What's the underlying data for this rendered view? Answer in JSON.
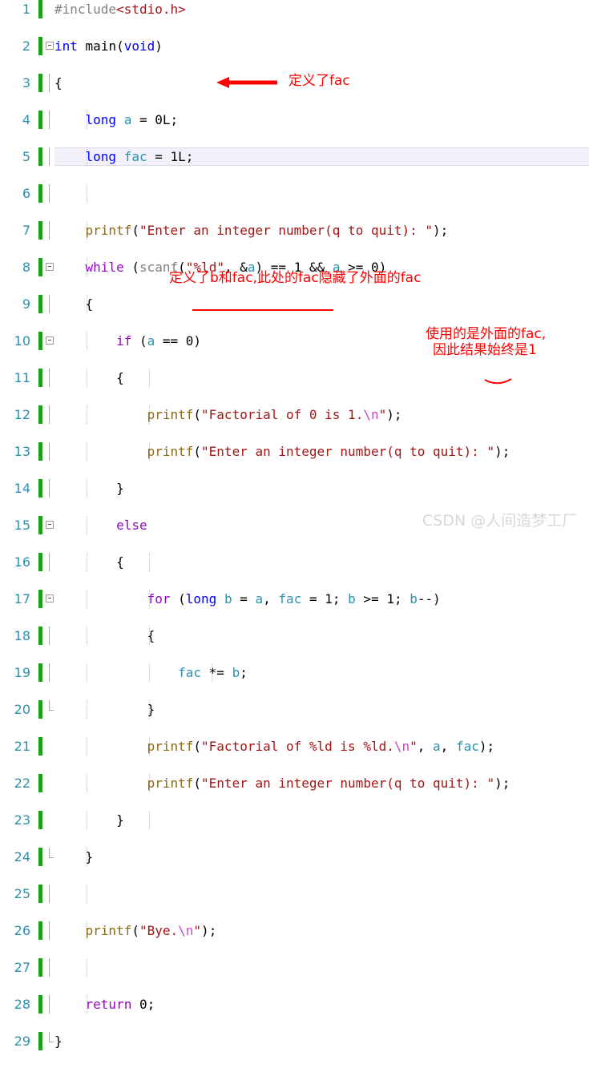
{
  "editor": {
    "language": "c",
    "current_line": 5,
    "line_number_color": "#2b91af",
    "modified_bar_color": "#16a016",
    "current_line_highlight": "#f2f0f8",
    "lines": [
      {
        "n": "1",
        "indent": 0,
        "fold": "none"
      },
      {
        "n": "2",
        "indent": 0,
        "fold": "open"
      },
      {
        "n": "3",
        "indent": 0,
        "fold": "none"
      },
      {
        "n": "4",
        "indent": 1,
        "fold": "none"
      },
      {
        "n": "5",
        "indent": 1,
        "fold": "none"
      },
      {
        "n": "6",
        "indent": 1,
        "fold": "none"
      },
      {
        "n": "7",
        "indent": 1,
        "fold": "none"
      },
      {
        "n": "8",
        "indent": 1,
        "fold": "open"
      },
      {
        "n": "9",
        "indent": 1,
        "fold": "none"
      },
      {
        "n": "10",
        "indent": 2,
        "fold": "open"
      },
      {
        "n": "11",
        "indent": 2,
        "fold": "none"
      },
      {
        "n": "12",
        "indent": 3,
        "fold": "none"
      },
      {
        "n": "13",
        "indent": 3,
        "fold": "none"
      },
      {
        "n": "14",
        "indent": 2,
        "fold": "none"
      },
      {
        "n": "15",
        "indent": 2,
        "fold": "open"
      },
      {
        "n": "16",
        "indent": 2,
        "fold": "none"
      },
      {
        "n": "17",
        "indent": 3,
        "fold": "open"
      },
      {
        "n": "18",
        "indent": 3,
        "fold": "none"
      },
      {
        "n": "19",
        "indent": 4,
        "fold": "none"
      },
      {
        "n": "20",
        "indent": 3,
        "fold": "none"
      },
      {
        "n": "21",
        "indent": 3,
        "fold": "none"
      },
      {
        "n": "22",
        "indent": 3,
        "fold": "none"
      },
      {
        "n": "23",
        "indent": 2,
        "fold": "none"
      },
      {
        "n": "24",
        "indent": 1,
        "fold": "none"
      },
      {
        "n": "25",
        "indent": 1,
        "fold": "none"
      },
      {
        "n": "26",
        "indent": 1,
        "fold": "none"
      },
      {
        "n": "27",
        "indent": 1,
        "fold": "none"
      },
      {
        "n": "28",
        "indent": 1,
        "fold": "none"
      },
      {
        "n": "29",
        "indent": 0,
        "fold": "none"
      }
    ],
    "code_text": {
      "l1": "#include<stdio.h>",
      "l2": "int main(void)",
      "l3": "{",
      "l4": "    long a = 0L;",
      "l5": "    long fac = 1L;",
      "l6": "",
      "l7": "    printf(\"Enter an integer number(q to quit): \");",
      "l8": "    while (scanf(\"%ld\", &a) == 1 && a >= 0)",
      "l9": "    {",
      "l10": "        if (a == 0)",
      "l11": "        {",
      "l12": "            printf(\"Factorial of 0 is 1.\\n\");",
      "l13": "            printf(\"Enter an integer number(q to quit): \");",
      "l14": "        }",
      "l15": "        else",
      "l16": "        {",
      "l17": "            for (long b = a, fac = 1; b >= 1; b--)",
      "l18": "            {",
      "l19": "                fac *= b;",
      "l20": "            }",
      "l21": "            printf(\"Factorial of %ld is %ld.\\n\", a, fac);",
      "l22": "            printf(\"Enter an integer number(q to quit): \");",
      "l23": "        }",
      "l24": "    }",
      "l25": "",
      "l26": "    printf(\"Bye.\\n\");",
      "l27": "",
      "l28": "    return 0;",
      "l29": "}"
    }
  },
  "annotations": {
    "color": "#ff0000",
    "line5_note": "定义了fac",
    "line16_note": "定义了b和fac,此处的fac隐藏了外面的fac",
    "line19_note_line1": "使用的是外面的fac,",
    "line19_note_line2": "因此结果始终是1"
  },
  "watermark": {
    "text": "CSDN @人间造梦工厂",
    "color": "#d8d8d8"
  }
}
